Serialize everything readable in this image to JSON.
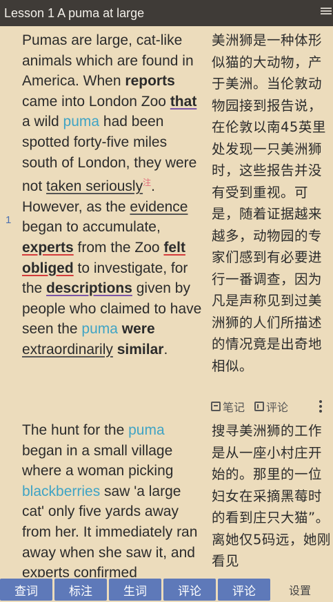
{
  "header": {
    "title": "Lesson 1 A puma at large"
  },
  "paragraph_number": "1",
  "para1": {
    "en": [
      {
        "t": "Pumas are large, cat-like animals which are found in America. When "
      },
      {
        "t": "reports",
        "c": "bold"
      },
      {
        "t": " came into London Zoo "
      },
      {
        "t": "that",
        "c": "bold uline-purple"
      },
      {
        "t": " a wild "
      },
      {
        "t": "puma",
        "c": "blue"
      },
      {
        "t": " had been spotted forty-five miles south of London, they were not "
      },
      {
        "t": "taken seriously",
        "c": "uline-gray"
      },
      {
        "t": "注",
        "c": "note-mark"
      },
      {
        "t": ". However, as the "
      },
      {
        "t": "evidence",
        "c": "uline-gray"
      },
      {
        "t": " began to accumulate, "
      },
      {
        "t": "experts",
        "c": "bold uline-red"
      },
      {
        "t": " from the Zoo "
      },
      {
        "t": "felt obliged",
        "c": "bold uline-red"
      },
      {
        "t": " to investigate, for the "
      },
      {
        "t": "descriptions",
        "c": "bold uline-purple"
      },
      {
        "t": " given by people who claimed to have seen the "
      },
      {
        "t": "puma",
        "c": "blue"
      },
      {
        "t": " "
      },
      {
        "t": "were",
        "c": "bold"
      },
      {
        "t": " "
      },
      {
        "t": "extraordinarily",
        "c": "uline-gray"
      },
      {
        "t": " "
      },
      {
        "t": "similar",
        "c": "bold"
      },
      {
        "t": "."
      }
    ],
    "zh": "美洲狮是一种体形似猫的大动物，产于美洲。当伦敦动物园接到报告说，在伦敦以南45英里处发现一只美洲狮时，这些报告并没有受到重视。可是，随着证据越来越多，动物园的专家们感到有必要进行一番调查，因为凡是声称见到过美洲狮的人们所描述的情况竟是出奇地相似。"
  },
  "actions": {
    "notes": "笔记",
    "comments": "评论"
  },
  "para2": {
    "en": [
      {
        "t": "The hunt for the "
      },
      {
        "t": "puma",
        "c": "blue"
      },
      {
        "t": " began in a small village where a woman picking "
      },
      {
        "t": "blackberries",
        "c": "blue"
      },
      {
        "t": " saw 'a large cat' only five yards away from her. It immediately ran away when she saw it, and experts confirmed"
      }
    ],
    "zh": "搜寻美洲狮的工作是从一座小村庄开始的。那里的一位妇女在采摘黑莓时的看到庄只大猫”。离她仅5码远，她刚看见"
  },
  "bottom": {
    "lookup": "查词",
    "annotate": "标注",
    "vocab": "生词",
    "comment1": "评论",
    "comment2": "评论",
    "settings": "设置"
  }
}
